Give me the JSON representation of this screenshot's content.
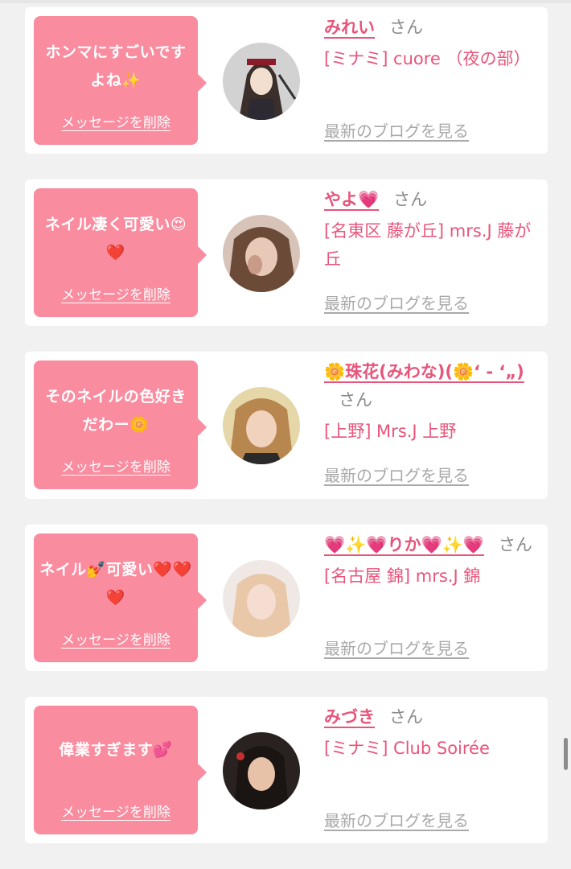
{
  "common": {
    "delete_label": "メッセージを削除",
    "san": "さん",
    "blog_label": "最新のブログを見る"
  },
  "cards": [
    {
      "message": "ホンマにすごいですよね✨",
      "name": "みれい",
      "shop": "[ミナミ] cuore （夜の部）",
      "avatar_colors": [
        "#cfcfcf",
        "#3a2f2a",
        "#f3dfcf"
      ]
    },
    {
      "message": "ネイル凄く可愛い😍❤️",
      "name": "やよ💗",
      "shop": "[名東区 藤が丘] mrs.J 藤が丘",
      "avatar_colors": [
        "#d6c0b4",
        "#6b4a38",
        "#e8c8b6"
      ]
    },
    {
      "message": "そのネイルの色好きだわー🌼",
      "name": "🌼珠花(みわな)(🌼‘ - ‘„)",
      "shop": "[上野] Mrs.J 上野",
      "avatar_colors": [
        "#e5d7a8",
        "#b8874f",
        "#f1d2bd"
      ]
    },
    {
      "message": "ネイル💅可愛い❤️❤️❤️",
      "name": "💗✨💗りか💗✨💗",
      "shop": "[名古屋 錦] mrs.J 錦",
      "avatar_colors": [
        "#f0e8e4",
        "#e8c8a8",
        "#f6ddd2"
      ]
    },
    {
      "message": "偉業すぎます💕",
      "name": "みづき",
      "shop": "[ミナミ] Club Soirée",
      "avatar_colors": [
        "#2a2220",
        "#1a1412",
        "#e7c1a8"
      ]
    }
  ]
}
